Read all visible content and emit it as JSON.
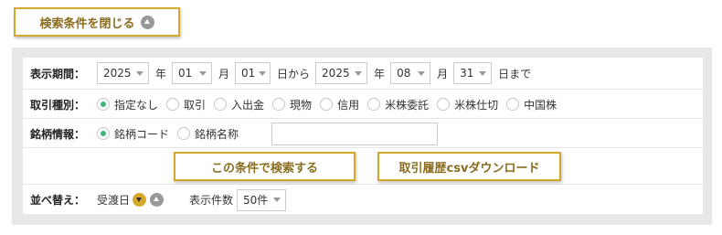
{
  "toggle": {
    "label": "検索条件を閉じる",
    "icon": "chevron-up-circle-icon"
  },
  "period": {
    "label": "表示期間：",
    "from": {
      "year": "2025",
      "month": "01",
      "day": "01"
    },
    "to": {
      "year": "2025",
      "month": "08",
      "day": "31"
    },
    "units": {
      "year": "年",
      "month": "月",
      "day_from": "日から",
      "day_to": "日まで"
    }
  },
  "trade_type": {
    "label": "取引種別：",
    "options": [
      "指定なし",
      "取引",
      "入出金",
      "現物",
      "信用",
      "米株委託",
      "米株仕切",
      "中国株"
    ],
    "selected": 0
  },
  "stock_info": {
    "label": "銘柄情報：",
    "options": [
      "銘柄コード",
      "銘柄名称"
    ],
    "selected": 0,
    "input_value": ""
  },
  "actions": {
    "search": "この条件で検索する",
    "download": "取引履歴csvダウンロード"
  },
  "sort": {
    "label": "並べ替え：",
    "field": "受渡日",
    "count_label": "表示件数",
    "count_value": "50件"
  },
  "colors": {
    "accent": "#d4a92b",
    "accent_text": "#8a6d1e",
    "radio_checked": "#3cb878"
  }
}
